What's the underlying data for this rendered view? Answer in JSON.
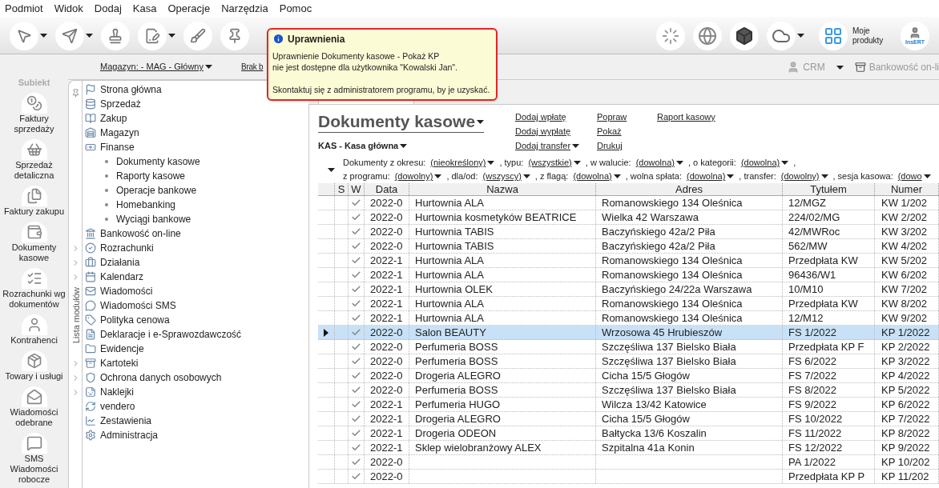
{
  "menu": [
    {
      "label": "Podmiot"
    },
    {
      "label": "Widok"
    },
    {
      "label": "Dodaj"
    },
    {
      "label": "Kasa"
    },
    {
      "label": "Operacje"
    },
    {
      "label": "Narzędzia"
    },
    {
      "label": "Pomoc"
    }
  ],
  "toolbar": {
    "products_label": "Moje produkty",
    "user_badge": "InsERT"
  },
  "subbar": {
    "warehouse": "Magazyn: - MAG - Główny",
    "cut_link": "Brak b",
    "crm": "CRM",
    "banking": "Bankowość on-li"
  },
  "sidebar": {
    "brand": "Subiekt",
    "items": [
      {
        "label": "Faktury sprzedaży"
      },
      {
        "label": "Sprzedaż detaliczna"
      },
      {
        "label": "Faktury zakupu"
      },
      {
        "label": "Dokumenty kasowe"
      },
      {
        "label": "Rozrachunki wg dokumentów"
      },
      {
        "label": "Kontrahenci"
      },
      {
        "label": "Towary i usługi"
      },
      {
        "label": "Wiadomości odebrane"
      },
      {
        "label": "SMS Wiadomości robocze"
      }
    ]
  },
  "module_list": {
    "label": "Lista modułów",
    "items": [
      {
        "label": "Strona główna",
        "expandable": false
      },
      {
        "label": "Sprzedaż",
        "expandable": false
      },
      {
        "label": "Zakup",
        "expandable": false
      },
      {
        "label": "Magazyn",
        "expandable": false
      },
      {
        "label": "Finanse",
        "expandable": false,
        "children": [
          {
            "label": "Dokumenty kasowe"
          },
          {
            "label": "Raporty kasowe"
          },
          {
            "label": "Operacje bankowe"
          },
          {
            "label": "Homebanking"
          },
          {
            "label": "Wyciągi bankowe"
          }
        ]
      },
      {
        "label": "Bankowość on-line",
        "expandable": false
      },
      {
        "label": "Rozrachunki",
        "expandable": true
      },
      {
        "label": "Działania",
        "expandable": true
      },
      {
        "label": "Kalendarz",
        "expandable": true
      },
      {
        "label": "Wiadomości",
        "expandable": false
      },
      {
        "label": "Wiadomości SMS",
        "expandable": false
      },
      {
        "label": "Polityka cenowa",
        "expandable": false
      },
      {
        "label": "Deklaracje i e-Sprawozdawczość",
        "expandable": false
      },
      {
        "label": "Ewidencje",
        "expandable": false
      },
      {
        "label": "Kartoteki",
        "expandable": true
      },
      {
        "label": "Ochrona danych osobowych",
        "expandable": true
      },
      {
        "label": "Naklejki",
        "expandable": true
      },
      {
        "label": "vendero",
        "expandable": false
      },
      {
        "label": "Zestawienia",
        "expandable": false
      },
      {
        "label": "Administracja",
        "expandable": false
      }
    ]
  },
  "tooltip": {
    "title": "Uprawnienia",
    "lines": [
      "Uprawnienie Dokumenty kasowe - Pokaż KP",
      "nie jest dostępne dla użytkownika \"Kowalski Jan\"."
    ],
    "note": "Skontaktuj się z administratorem programu, by je uzyskać."
  },
  "document": {
    "title": "Dokumenty kasowe",
    "register": "KAS - Kasa główna",
    "action_columns": [
      [
        {
          "label": "Dodaj wpłatę",
          "dropdown": false
        },
        {
          "label": "Dodaj wypłatę",
          "dropdown": false
        },
        {
          "label": "Dodaj transfer",
          "dropdown": true
        }
      ],
      [
        {
          "label": "Popraw",
          "dropdown": false
        },
        {
          "label": "Pokaż",
          "dropdown": false
        },
        {
          "label": "Drukuj",
          "dropdown": false
        }
      ],
      [
        {
          "label": "Raport kasowy",
          "dropdown": false
        }
      ]
    ],
    "filters": [
      [
        {
          "kind": "label",
          "text": "Dokumenty z okresu:"
        },
        {
          "kind": "dropdown",
          "text": "(nieokreślony)"
        },
        {
          "kind": "label",
          "text": ", typu:"
        },
        {
          "kind": "dropdown",
          "text": "(wszystkie)"
        },
        {
          "kind": "label",
          "text": ", w walucie:"
        },
        {
          "kind": "dropdown",
          "text": "(dowolna)"
        },
        {
          "kind": "label",
          "text": ", o kategorii:"
        },
        {
          "kind": "dropdown",
          "text": "(dowolna)"
        },
        {
          "kind": "label",
          "text": ","
        }
      ],
      [
        {
          "kind": "label",
          "text": "z programu:"
        },
        {
          "kind": "dropdown",
          "text": "(dowolny)"
        },
        {
          "kind": "label",
          "text": ", dla/od:"
        },
        {
          "kind": "dropdown",
          "text": "(wszyscy)"
        },
        {
          "kind": "label",
          "text": ", z flagą:"
        },
        {
          "kind": "dropdown",
          "text": "(dowolna)"
        },
        {
          "kind": "label",
          "text": ", wolna spłata:"
        },
        {
          "kind": "dropdown",
          "text": "(dowolna)"
        },
        {
          "kind": "label",
          "text": ", transfer:"
        },
        {
          "kind": "dropdown",
          "text": "(dowolny)"
        },
        {
          "kind": "label",
          "text": ", sesja kasowa:"
        },
        {
          "kind": "dropdown",
          "text": "(dowo"
        }
      ]
    ],
    "table": {
      "columns": [
        "S",
        "W",
        "Data",
        "Nazwa",
        "Adres",
        "Tytułem",
        "Numer"
      ],
      "rows": [
        {
          "selected": false,
          "w": true,
          "date": "2022-0",
          "name": "Hurtownia ALA",
          "address": "Romanowskiego 134 Oleśnica",
          "title": "12/MGZ",
          "number": "KW 1/202"
        },
        {
          "selected": false,
          "w": true,
          "date": "2022-0",
          "name": "Hurtownia kosmetyków BEATRICE",
          "address": "Wielka  42 Warszawa",
          "title": "224/02/MG",
          "number": "KW 2/202"
        },
        {
          "selected": false,
          "w": true,
          "date": "2022-0",
          "name": "Hurtownia TABIS",
          "address": "Baczyńskiego  42a/2 Piła",
          "title": "42/MWRoc",
          "number": "KW 3/202"
        },
        {
          "selected": false,
          "w": true,
          "date": "2022-0",
          "name": "Hurtownia TABIS",
          "address": "Baczyńskiego  42a/2 Piła",
          "title": "562/MW",
          "number": "KW 4/202"
        },
        {
          "selected": false,
          "w": true,
          "date": "2022-1",
          "name": "Hurtownia ALA",
          "address": "Romanowskiego 134 Oleśnica",
          "title": "Przedpłata KW",
          "number": "KW 5/202"
        },
        {
          "selected": false,
          "w": true,
          "date": "2022-1",
          "name": "Hurtownia ALA",
          "address": "Romanowskiego 134 Oleśnica",
          "title": "96436/W1",
          "number": "KW 6/202"
        },
        {
          "selected": false,
          "w": true,
          "date": "2022-1",
          "name": "Hurtownia OLEK",
          "address": "Baczyńskiego  24/22a Warszawa",
          "title": "10/M10",
          "number": "KW 7/202"
        },
        {
          "selected": false,
          "w": true,
          "date": "2022-1",
          "name": "Hurtownia ALA",
          "address": "Romanowskiego 134 Oleśnica",
          "title": "Przedpłata KW",
          "number": "KW 8/202"
        },
        {
          "selected": false,
          "w": true,
          "date": "2022-1",
          "name": "Hurtownia ALA",
          "address": "Romanowskiego 134 Oleśnica",
          "title": "12/M12",
          "number": "KW 9/202"
        },
        {
          "selected": true,
          "w": true,
          "date": "2022-0",
          "name": "Salon BEAUTY",
          "address": "Wrzosowa  45 Hrubieszów",
          "title": "FS 1/2022",
          "number": "KP 1/2022"
        },
        {
          "selected": false,
          "w": true,
          "date": "2022-0",
          "name": "Perfumeria BOSS",
          "address": "Szczęśliwa  137 Bielsko Biała",
          "title": "Przedpłata KP F",
          "number": "KP 2/2022"
        },
        {
          "selected": false,
          "w": true,
          "date": "2022-0",
          "name": "Perfumeria BOSS",
          "address": "Szczęśliwa  137 Bielsko Biała",
          "title": "FS 6/2022",
          "number": "KP 3/2022"
        },
        {
          "selected": false,
          "w": true,
          "date": "2022-0",
          "name": "Drogeria ALEGRO",
          "address": "Cicha  15/5 Głogów",
          "title": "FS 7/2022",
          "number": "KP 4/2022"
        },
        {
          "selected": false,
          "w": true,
          "date": "2022-0",
          "name": "Perfumeria BOSS",
          "address": "Szczęśliwa  137 Bielsko Biała",
          "title": "FS 8/2022",
          "number": "KP 5/2022"
        },
        {
          "selected": false,
          "w": true,
          "date": "2022-1",
          "name": "Perfumeria HUGO",
          "address": "Wilcza  13/42 Katowice",
          "title": "FS 9/2022",
          "number": "KP 6/2022"
        },
        {
          "selected": false,
          "w": true,
          "date": "2022-1",
          "name": "Drogeria ALEGRO",
          "address": "Cicha  15/5 Głogów",
          "title": "FS 10/2022",
          "number": "KP 7/2022"
        },
        {
          "selected": false,
          "w": true,
          "date": "2022-1",
          "name": "Drogeria ODEON",
          "address": "Bałtycka  13/6 Koszalin",
          "title": "FS 11/2022",
          "number": "KP 8/2022"
        },
        {
          "selected": false,
          "w": true,
          "date": "2022-1",
          "name": "Sklep wielobranżowy  ALEX",
          "address": "Szpitalna  41a Konin",
          "title": "FS 12/2022",
          "number": "KP 9/2022"
        },
        {
          "selected": false,
          "w": true,
          "date": "2022-0",
          "title": "PA 1/2022",
          "number": "KP 10/202"
        },
        {
          "selected": false,
          "w": true,
          "date": "2022-0",
          "title": "Przedpłata KP P",
          "number": "KP 11/202"
        }
      ]
    }
  }
}
